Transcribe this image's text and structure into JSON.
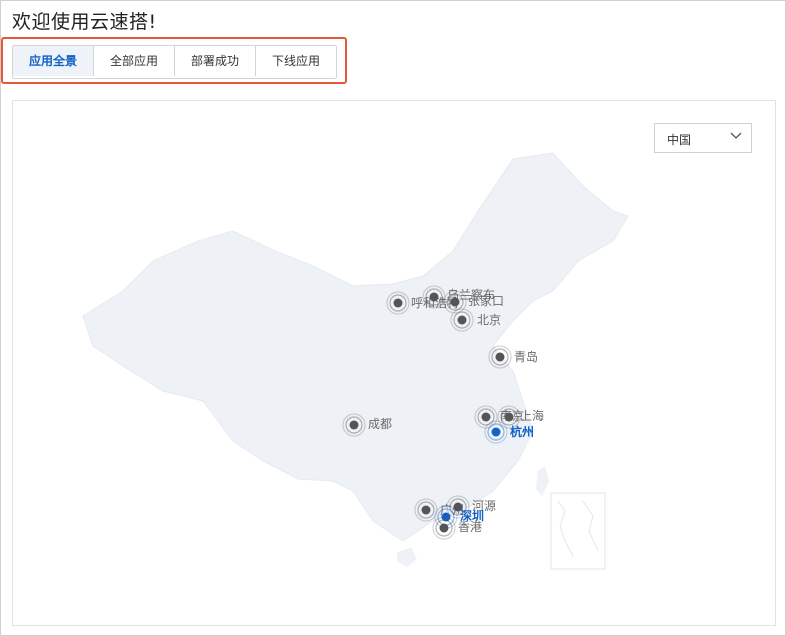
{
  "page": {
    "title": "欢迎使用云速搭!"
  },
  "tabs": [
    {
      "label": "应用全景",
      "active": true
    },
    {
      "label": "全部应用",
      "active": false
    },
    {
      "label": "部署成功",
      "active": false
    },
    {
      "label": "下线应用",
      "active": false
    }
  ],
  "region_select": {
    "value": "中国",
    "icon": "chevron-down-icon"
  },
  "map": {
    "cities": [
      {
        "name": "呼和浩特",
        "highlight": false
      },
      {
        "name": "乌兰察布",
        "highlight": false
      },
      {
        "name": "张家口",
        "highlight": false
      },
      {
        "name": "北京",
        "highlight": false
      },
      {
        "name": "青岛",
        "highlight": false
      },
      {
        "name": "南京",
        "highlight": false
      },
      {
        "name": "上海",
        "highlight": false
      },
      {
        "name": "杭州",
        "highlight": true
      },
      {
        "name": "成都",
        "highlight": false
      },
      {
        "name": "广州",
        "highlight": false
      },
      {
        "name": "河源",
        "highlight": false
      },
      {
        "name": "深圳",
        "highlight": true
      },
      {
        "name": "香港",
        "highlight": false
      }
    ],
    "colors": {
      "land": "#eef1f6",
      "marker": "#555555",
      "marker_hl": "#1262c4"
    }
  }
}
